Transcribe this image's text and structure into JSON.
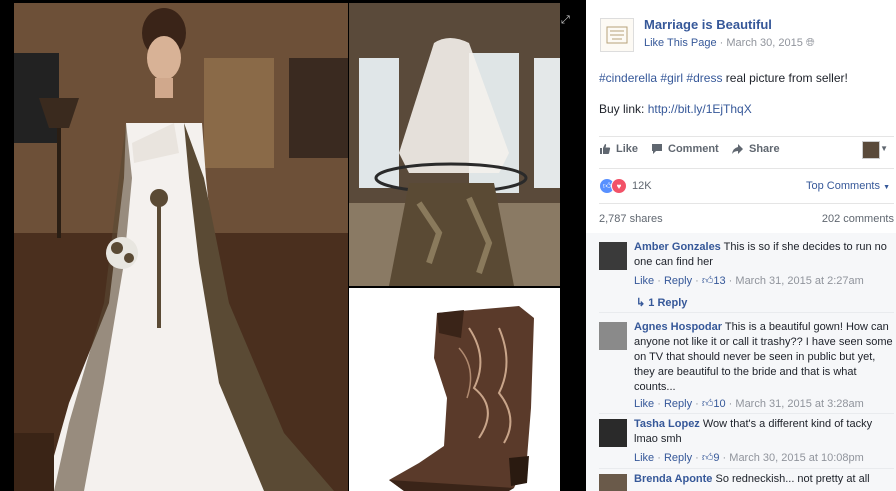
{
  "page": {
    "name": "Marriage is Beautiful",
    "like_page": "Like This Page",
    "date": "March 30, 2015",
    "separator": "·"
  },
  "post": {
    "tags": [
      "#cinderella",
      "#girl",
      "#dress"
    ],
    "text_suffix": " real picture from seller!",
    "buy_label": "Buy link: ",
    "buy_url": "http://bit.ly/1EjThqX"
  },
  "actions": {
    "like": "Like",
    "comment": "Comment",
    "share": "Share"
  },
  "stats": {
    "reactions": "12K",
    "top_comments": "Top Comments",
    "shares": "2,787 shares",
    "comments": "202 comments"
  },
  "colors": {
    "link": "#365899",
    "like_blue": "#5890ff",
    "love_red": "#f25268"
  },
  "comments": [
    {
      "author": "Amber Gonzales",
      "text": "This is so if she decides to run no one can find her",
      "like": "Like",
      "reply": "Reply",
      "likes": "13",
      "time": "March 31, 2015 at 2:27am",
      "replies": "1 Reply",
      "avatar_color": "#3a3a3a"
    },
    {
      "author": "Agnes Hospodar",
      "text": "This is a beautiful gown! How can anyone not like it or call it trashy?? I have seen some on TV that should never be seen in public but yet, they are beautiful to the bride and that is what counts...",
      "like": "Like",
      "reply": "Reply",
      "likes": "10",
      "time": "March 31, 2015 at 3:28am",
      "avatar_color": "#8a8a8a"
    },
    {
      "author": "Tasha Lopez",
      "text": "Wow that's a different kind of tacky lmao smh",
      "like": "Like",
      "reply": "Reply",
      "likes": "9",
      "time": "March 30, 2015 at 10:08pm",
      "avatar_color": "#2a2a2a"
    },
    {
      "author": "Brenda Aponte",
      "text": "So redneckish... not pretty at all",
      "avatar_color": "#6a5a4a"
    }
  ]
}
